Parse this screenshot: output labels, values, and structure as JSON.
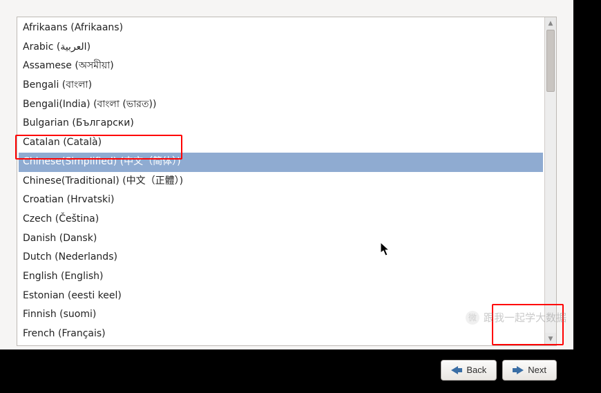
{
  "languages": [
    {
      "label": "Afrikaans (Afrikaans)"
    },
    {
      "label": "Arabic (العربية)"
    },
    {
      "label": "Assamese (অসমীয়া)"
    },
    {
      "label": "Bengali (বাংলা)"
    },
    {
      "label": "Bengali(India) (বাংলা (ভারত))"
    },
    {
      "label": "Bulgarian (Български)"
    },
    {
      "label": "Catalan (Català)"
    },
    {
      "label": "Chinese(Simplified) (中文（简体）)",
      "selected": true
    },
    {
      "label": "Chinese(Traditional) (中文（正體）)"
    },
    {
      "label": "Croatian (Hrvatski)"
    },
    {
      "label": "Czech (Čeština)"
    },
    {
      "label": "Danish (Dansk)"
    },
    {
      "label": "Dutch (Nederlands)"
    },
    {
      "label": "English (English)"
    },
    {
      "label": "Estonian (eesti keel)"
    },
    {
      "label": "Finnish (suomi)"
    },
    {
      "label": "French (Français)"
    }
  ],
  "buttons": {
    "back": "Back",
    "next": "Next"
  },
  "watermark": "跟我一起学大数据"
}
